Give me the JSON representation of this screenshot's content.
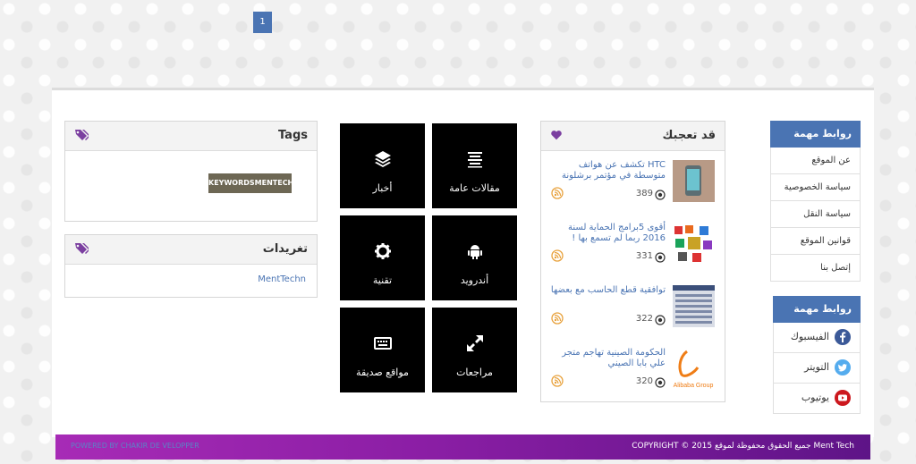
{
  "pagination": {
    "current": "1"
  },
  "tags_box": {
    "title": "Tags",
    "tag": "KEYWORDSMENTECH"
  },
  "tweets_box": {
    "title": "تغريدات",
    "user": "MentTechn"
  },
  "tiles": [
    {
      "label": "مقالات عامة",
      "icon": "lines-icon"
    },
    {
      "label": "أخبار",
      "icon": "layers-icon"
    },
    {
      "label": "أندرويد",
      "icon": "android-icon"
    },
    {
      "label": "تقنية",
      "icon": "gear-icon"
    },
    {
      "label": "مراجعات",
      "icon": "expand-icon"
    },
    {
      "label": "مواقع صديقة",
      "icon": "keyboard-icon"
    }
  ],
  "likes_box": {
    "title": "قد تعجبك",
    "posts": [
      {
        "title": "HTC تكشف عن هواتف متوسطة في مؤتمر برشلونة",
        "views": "389"
      },
      {
        "title": "أقوى 5برامج الحماية لسنة 2016 ربما لم تسمع بها !",
        "views": "331"
      },
      {
        "title": "توافقية قطع الحاسب مع بعضها",
        "views": "322"
      },
      {
        "title": "الحكومة الصينية تهاجم متجر علي بابا الصيني",
        "views": "320",
        "thumb_text": "Alibaba Group"
      }
    ]
  },
  "links_box": {
    "title": "روابط مهمة",
    "items": [
      "عن الموقع",
      "سياسة الخصوصية",
      "سياسة النقل",
      "قوانين الموقع",
      "إتصل بنا"
    ]
  },
  "social_box": {
    "title": "روابط مهمة",
    "items": [
      {
        "label": "الفيسبوك",
        "icon": "facebook-icon",
        "color": "#3b5998"
      },
      {
        "label": "التويتر",
        "icon": "twitter-icon",
        "color": "#55acee"
      },
      {
        "label": "يوتيوب",
        "icon": "youtube-icon",
        "color": "#cc181e"
      }
    ]
  },
  "footer": {
    "left": "POWERED BY CHAKIR DE VELOPPER",
    "right": "COPYRIGHT © 2015 جميع الحقوق محفوظة لموقع Ment Tech"
  },
  "colors": {
    "accent": "#4a74b3",
    "tag_icon": "#7b3fa0",
    "footer_start": "#a72bb6",
    "footer_end": "#5e1487"
  }
}
